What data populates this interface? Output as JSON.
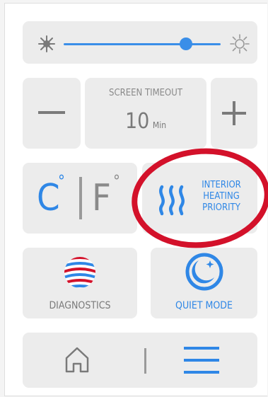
{
  "brightness": {
    "min_icon": "brightness-low-icon",
    "max_icon": "brightness-high-icon",
    "level": 0.78,
    "accent": "#3a8ee8"
  },
  "screen_timeout": {
    "title": "SCREEN TIMEOUT",
    "value": "10",
    "unit": "Min",
    "decrease_icon": "minus-icon",
    "increase_icon": "plus-icon"
  },
  "units": {
    "celsius": "C",
    "fahrenheit": "F",
    "degree": "°"
  },
  "interior_heating": {
    "line1": "INTERIOR",
    "line2": "HEATING",
    "line3": "PRIORITY",
    "icon": "heat-waves-icon"
  },
  "diagnostics": {
    "label": "DIAGNOSTICS",
    "icon": "diagnostics-globe-icon"
  },
  "quiet_mode": {
    "label": "QUIET MODE",
    "icon": "moon-icon"
  },
  "nav": {
    "home_icon": "home-icon",
    "menu_icon": "menu-icon"
  },
  "annotation": {
    "color": "#d3112a"
  }
}
